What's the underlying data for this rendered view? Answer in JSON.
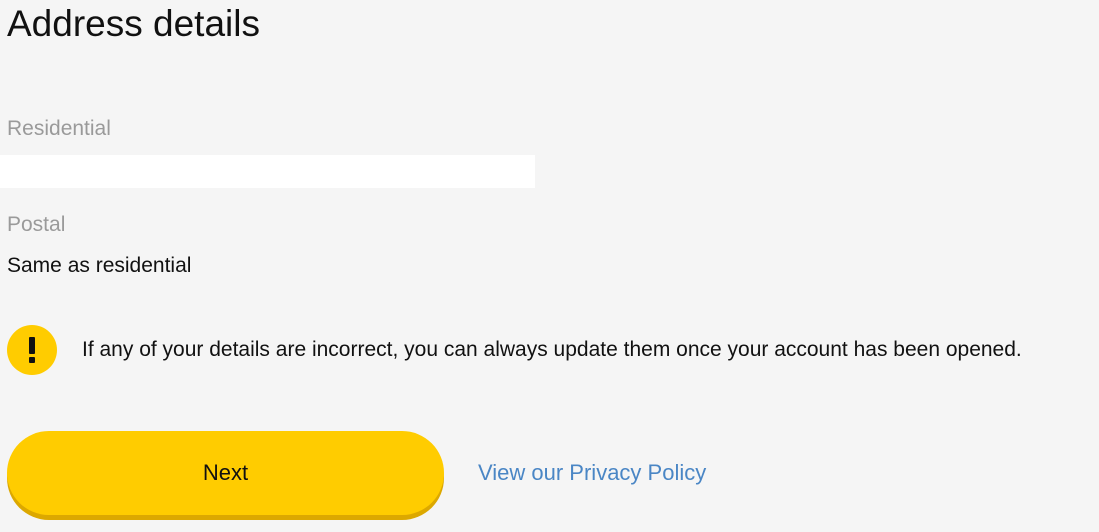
{
  "page": {
    "title": "Address details"
  },
  "residential": {
    "label": "Residential",
    "value": ""
  },
  "postal": {
    "label": "Postal",
    "value": "Same as residential"
  },
  "notice": {
    "icon": "exclamation-icon",
    "icon_glyph": "!",
    "text": "If any of your details are incorrect, you can always update them once your account has been opened."
  },
  "actions": {
    "next_label": "Next",
    "privacy_link": "View our Privacy Policy"
  },
  "colors": {
    "accent": "#ffcc00",
    "link": "#4a86c5",
    "background": "#f5f5f5"
  }
}
